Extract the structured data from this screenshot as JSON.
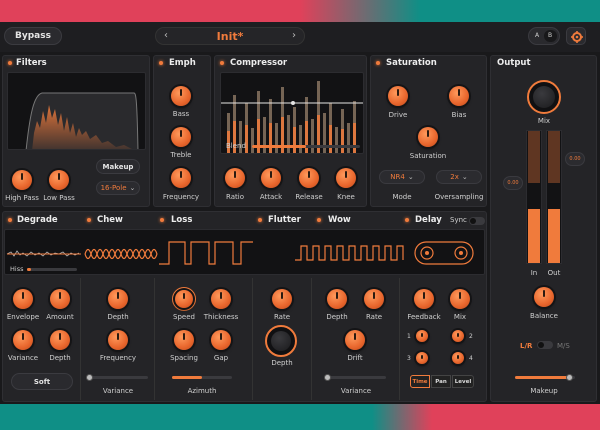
{
  "header": {
    "bypass_label": "Bypass",
    "preset_name": "Init*",
    "prev_arrow": "‹",
    "next_arrow": "›",
    "ab": {
      "a": "A",
      "b": "B"
    }
  },
  "filters": {
    "title": "Filters",
    "knobs": [
      "High Pass",
      "Low Pass"
    ],
    "makeup_label": "Makeup",
    "slope_value": "16-Pole"
  },
  "emph": {
    "title": "Emph",
    "knobs": [
      "Bass",
      "Treble",
      "Frequency"
    ]
  },
  "compressor": {
    "title": "Compressor",
    "blend_label": "Blend",
    "knobs": [
      "Ratio",
      "Attack",
      "Release",
      "Knee"
    ]
  },
  "saturation": {
    "title": "Saturation",
    "knobs": [
      "Drive",
      "Bias",
      "Saturation"
    ],
    "mode_value": "NR4",
    "mode_label": "Mode",
    "oversampling_value": "2x",
    "oversampling_label": "Oversampling"
  },
  "output": {
    "title": "Output",
    "mix_label": "Mix",
    "meter_left": "0.00",
    "meter_right": "0.00",
    "in_label": "In",
    "out_label": "Out",
    "balance_label": "Balance",
    "lr_label": "L/R",
    "ms_label": "M/S",
    "makeup_label": "Makeup"
  },
  "degrade": {
    "title": "Degrade",
    "hiss_label": "Hiss",
    "knobs": [
      "Envelope",
      "Amount",
      "Variance",
      "Depth"
    ],
    "soft_label": "Soft"
  },
  "chew": {
    "title": "Chew",
    "knobs": [
      "Depth",
      "Frequency"
    ],
    "variance_label": "Variance"
  },
  "loss": {
    "title": "Loss",
    "knobs": [
      "Speed",
      "Thickness",
      "Spacing",
      "Gap"
    ],
    "azimuth_label": "Azimuth"
  },
  "flutter": {
    "title": "Flutter",
    "knobs": [
      "Rate",
      "Depth"
    ]
  },
  "wow": {
    "title": "Wow",
    "knobs": [
      "Depth",
      "Rate",
      "Drift"
    ],
    "variance_label": "Variance"
  },
  "delay": {
    "title": "Delay",
    "sync_label": "Sync",
    "knobs": [
      "Feedback",
      "Mix"
    ],
    "heads": [
      "1",
      "2",
      "3",
      "4"
    ],
    "tabs": [
      "Time",
      "Pan",
      "Level"
    ]
  },
  "colors": {
    "accent": "#f07b3c",
    "panel": "#242427",
    "bg_red": "#e0415a",
    "bg_teal": "#0f8f86"
  }
}
